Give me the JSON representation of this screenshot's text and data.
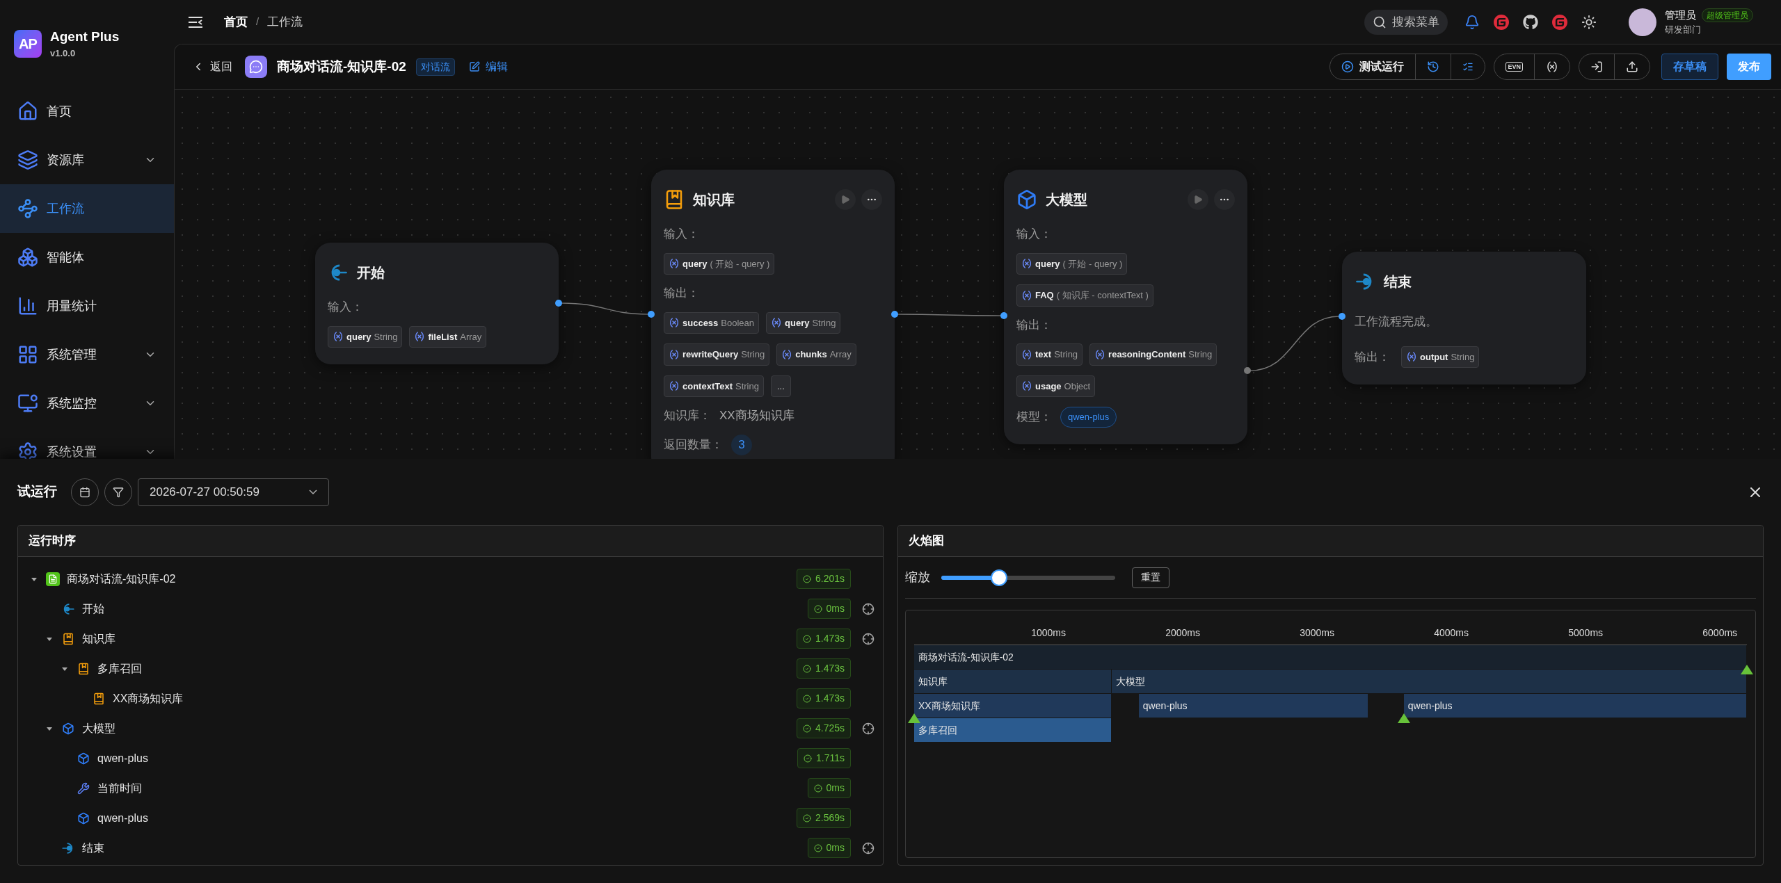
{
  "sidebar": {
    "logo": "AP",
    "app_name": "Agent Plus",
    "version": "v1.0.0",
    "items": [
      {
        "kind": "home",
        "label": "首页",
        "has_submenu": false,
        "selected": false
      },
      {
        "kind": "resources",
        "label": "资源库",
        "has_submenu": true,
        "selected": false
      },
      {
        "kind": "workflow",
        "label": "工作流",
        "has_submenu": false,
        "selected": true
      },
      {
        "kind": "agent",
        "label": "智能体",
        "has_submenu": false,
        "selected": false
      },
      {
        "kind": "stats",
        "label": "用量统计",
        "has_submenu": false,
        "selected": false
      },
      {
        "kind": "system",
        "label": "系统管理",
        "has_submenu": true,
        "selected": false
      },
      {
        "kind": "monitor",
        "label": "系统监控",
        "has_submenu": true,
        "selected": false
      },
      {
        "kind": "settings",
        "label": "系统设置",
        "has_submenu": true,
        "selected": false
      }
    ]
  },
  "header": {
    "breadcrumb": [
      "首页",
      "工作流"
    ],
    "separator": "/",
    "search_label": "搜索菜单",
    "user": {
      "name": "管理员",
      "role": "超级管理员",
      "department": "研发部门"
    }
  },
  "toolbar": {
    "back": "返回",
    "title": "商场对话流-知识库-02",
    "tag": "对话流",
    "edit": "编辑",
    "test_run": "测试运行",
    "env": "EVN",
    "save_draft": "存草稿",
    "publish": "发布"
  },
  "canvas": {
    "nodes": [
      {
        "kind": "start",
        "title": "开始",
        "sections": [
          {
            "label": "输入：",
            "chips": [
              {
                "kind": "var",
                "name": "query",
                "type": "String"
              },
              {
                "kind": "var",
                "name": "fileList",
                "type": "Array"
              }
            ]
          }
        ]
      },
      {
        "kind": "knowledge",
        "title": "知识库",
        "sections": [
          {
            "label": "输入：",
            "chips": [
              {
                "kind": "ref",
                "name": "query",
                "source": "( 开始 - query )"
              }
            ]
          },
          {
            "label": "输出：",
            "chips": [
              {
                "kind": "var",
                "name": "success",
                "type": "Boolean"
              },
              {
                "kind": "var",
                "name": "query",
                "type": "String"
              },
              {
                "kind": "var",
                "name": "rewriteQuery",
                "type": "String"
              },
              {
                "kind": "var",
                "name": "chunks",
                "type": "Array"
              },
              {
                "kind": "var",
                "name": "contextText",
                "type": "String"
              },
              {
                "kind": "more",
                "name": "..."
              }
            ]
          }
        ],
        "fields": [
          {
            "kind": "text",
            "label": "知识库：",
            "value": "XX商场知识库"
          },
          {
            "kind": "count",
            "label": "返回数量：",
            "value": "3"
          }
        ]
      },
      {
        "kind": "llm",
        "title": "大模型",
        "sections": [
          {
            "label": "输入：",
            "chips": [
              {
                "kind": "ref",
                "name": "query",
                "source": "( 开始 - query )"
              },
              {
                "kind": "ref",
                "name": "FAQ",
                "source": "( 知识库 - contextText )"
              }
            ]
          },
          {
            "label": "输出：",
            "chips": [
              {
                "kind": "var",
                "name": "text",
                "type": "String"
              },
              {
                "kind": "var",
                "name": "reasoningContent",
                "type": "String"
              },
              {
                "kind": "var",
                "name": "usage",
                "type": "Object"
              }
            ]
          }
        ],
        "fields": [
          {
            "kind": "pill",
            "label": "模型：",
            "value": "qwen-plus"
          }
        ]
      },
      {
        "kind": "end",
        "title": "结束",
        "description": "工作流程完成。",
        "sections": [
          {
            "label": "输出：",
            "chips": [
              {
                "kind": "var",
                "name": "output",
                "type": "String"
              }
            ]
          }
        ]
      }
    ]
  },
  "run_panel": {
    "title": "试运行",
    "run_time": "2026-07-27 00:50:59",
    "timeline": {
      "title": "运行时序",
      "items": [
        {
          "kind": "workflow",
          "label": "商场对话流-知识库-02",
          "duration": "6.201s",
          "locate": false,
          "expanded": true,
          "children": [
            {
              "kind": "start",
              "label": "开始",
              "duration": "0ms",
              "locate": true
            },
            {
              "kind": "knowledge",
              "label": "知识库",
              "duration": "1.473s",
              "locate": true,
              "expanded": true,
              "children": [
                {
                  "kind": "knowledge",
                  "label": "多库召回",
                  "duration": "1.473s",
                  "locate": false,
                  "expanded": true,
                  "children": [
                    {
                      "kind": "knowledge",
                      "label": "XX商场知识库",
                      "duration": "1.473s",
                      "locate": false
                    }
                  ]
                }
              ]
            },
            {
              "kind": "llm",
              "label": "大模型",
              "duration": "4.725s",
              "locate": true,
              "expanded": true,
              "children": [
                {
                  "kind": "llm",
                  "label": "qwen-plus",
                  "duration": "1.711s",
                  "locate": false
                },
                {
                  "kind": "tool",
                  "label": "当前时间",
                  "duration": "0ms",
                  "locate": false
                },
                {
                  "kind": "llm",
                  "label": "qwen-plus",
                  "duration": "2.569s",
                  "locate": false
                }
              ]
            },
            {
              "kind": "end",
              "label": "结束",
              "duration": "0ms",
              "locate": true
            }
          ]
        }
      ]
    },
    "flame_graph": {
      "title": "火焰图",
      "zoom": {
        "label": "缩放",
        "level": 0.33
      },
      "reset": "重置",
      "ticks": [
        "1000ms",
        "2000ms",
        "3000ms",
        "4000ms",
        "5000ms",
        "6000ms"
      ],
      "rows": [
        {
          "bars": [
            {
              "label": "商场对话流-知识库-02",
              "color": "#18222d"
            }
          ]
        },
        {
          "bars": [
            {
              "label": "知识库",
              "color": "#1d3047"
            },
            {
              "label": "大模型",
              "color": "#1d3047"
            }
          ]
        },
        {
          "bars": [
            {
              "label": "XX商场知识库",
              "color": "#20395a"
            },
            {
              "label": "qwen-plus",
              "color": "#20395a"
            },
            {
              "label": "qwen-plus",
              "color": "#20395a"
            }
          ]
        },
        {
          "bars": [
            {
              "label": "多库召回",
              "color": "#2b5b8f"
            }
          ]
        }
      ]
    }
  }
}
